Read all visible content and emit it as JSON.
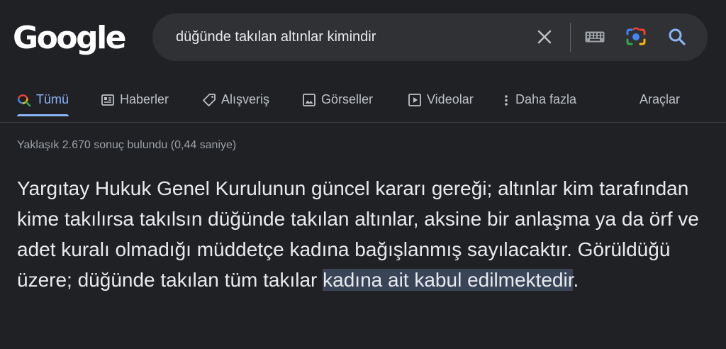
{
  "logo": "Google",
  "search": {
    "query": "düğünde takılan altınlar kimindir"
  },
  "icons": {
    "clear": "close-icon",
    "keyboard": "keyboard-icon",
    "lens": "camera-lens-icon",
    "search": "search-icon"
  },
  "tabs": [
    {
      "label": "Tümü",
      "icon": "search-icon",
      "active": true
    },
    {
      "label": "Haberler",
      "icon": "newspaper-icon"
    },
    {
      "label": "Alışveriş",
      "icon": "tag-icon"
    },
    {
      "label": "Görseller",
      "icon": "image-icon"
    },
    {
      "label": "Videolar",
      "icon": "play-icon"
    },
    {
      "label": "Daha fazla",
      "icon": "more-vert-icon"
    }
  ],
  "tools": "Araçlar",
  "stats": "Yaklaşık 2.670 sonuç bulundu (0,44 saniye)",
  "snippet": {
    "text": "Yargıtay Hukuk Genel Kurulunun güncel kararı gereği; altınlar kim tarafından kime takılırsa takılsın düğünde takılan altınlar, aksine bir anlaşma ya da örf ve adet kuralı olmadığı müddetçe kadına bağışlanmış sayılacaktır. Görüldüğü üzere; düğünde takılan tüm takılar ",
    "highlight": "kadına ait kabul edilmektedir",
    "end": "."
  },
  "colors": {
    "background": "#202124",
    "searchbar": "#303134",
    "accent": "#8ab4f8",
    "highlight": "#394457"
  }
}
